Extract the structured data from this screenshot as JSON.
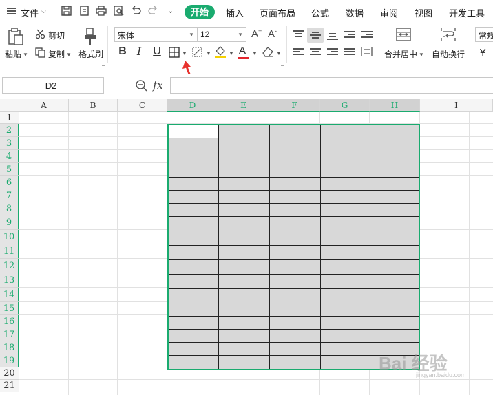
{
  "menu": {
    "file_label": "文件",
    "tabs": [
      "开始",
      "插入",
      "页面布局",
      "公式",
      "数据",
      "审阅",
      "视图",
      "开发工具"
    ]
  },
  "ribbon": {
    "paste_label": "粘贴",
    "cut_label": "剪切",
    "copy_label": "复制",
    "format_painter_label": "格式刷",
    "font_name": "宋体",
    "font_size": "12",
    "merge_center_label": "合并居中",
    "wrap_text_label": "自动换行",
    "number_format": "常规",
    "currency_symbol": "¥"
  },
  "formula_bar": {
    "name_box": "D2",
    "fx_label": "fx",
    "formula": ""
  },
  "sheet": {
    "columns": [
      "A",
      "B",
      "C",
      "D",
      "E",
      "F",
      "G",
      "H",
      "I"
    ],
    "selected_columns": [
      "D",
      "E",
      "F",
      "G",
      "H"
    ],
    "rows": [
      "1",
      "2",
      "3",
      "4",
      "5",
      "6",
      "7",
      "8",
      "9",
      "10",
      "11",
      "12",
      "13",
      "14",
      "15",
      "16",
      "17",
      "18",
      "19",
      "20",
      "21"
    ],
    "selected_rows_from": 2,
    "selected_rows_to": 19
  },
  "colors": {
    "accent": "#1aab6f",
    "range_fill": "#d8d8d8",
    "annotation_arrow": "#e8322d"
  },
  "watermark": {
    "text": "Bai 经验",
    "sub": "jingyan.baidu.com"
  }
}
